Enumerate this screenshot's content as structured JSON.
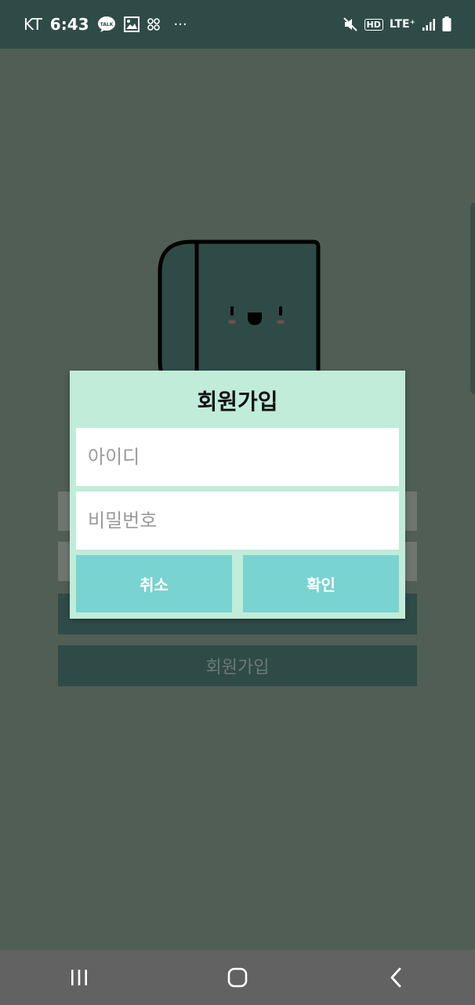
{
  "status_bar": {
    "carrier": "KT",
    "time": "6:43",
    "talk_badge": "TALK",
    "more": "···",
    "hd_badge": "HD",
    "network": "LTE⁺"
  },
  "main": {
    "bg_signup_button": "회원가입"
  },
  "dialog": {
    "title": "회원가입",
    "id_placeholder": "아이디",
    "password_placeholder": "비밀번호",
    "cancel_label": "취소",
    "confirm_label": "확인"
  },
  "colors": {
    "status_bar": "#2f4b48",
    "dim_background": "#505e55",
    "dialog_bg": "#c0ecd9",
    "button_bg": "#79d3d1",
    "nav_bar": "#626262"
  },
  "icons": {
    "status": [
      "talk-icon",
      "gallery-icon",
      "qr-icon",
      "more-icon",
      "mute-icon",
      "hd-icon",
      "signal-icon",
      "battery-icon"
    ],
    "navigation": [
      "recents-icon",
      "home-icon",
      "back-icon"
    ]
  }
}
